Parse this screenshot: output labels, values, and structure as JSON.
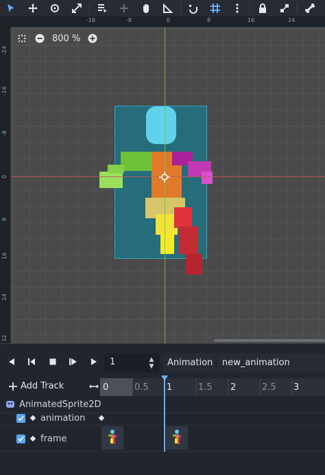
{
  "toolbar": {
    "icons": [
      "select-icon",
      "move-icon",
      "rotate-icon",
      "scale-icon",
      "list-select-icon",
      "pivot-icon",
      "pan-icon",
      "ruler-icon",
      "smart-snap-icon",
      "grid-snap-icon",
      "more-icon",
      "lock-icon",
      "group-icon",
      "bone-icon"
    ]
  },
  "rulers": {
    "top": [
      "-16",
      "-8",
      "0",
      "8",
      "16",
      "24"
    ],
    "left": [
      "-24",
      "-16",
      "-8",
      "0",
      "8",
      "16",
      "24",
      "32"
    ]
  },
  "viewport": {
    "zoom_text": "800 %"
  },
  "animation_panel": {
    "frame_value": "1",
    "animation_label": "Animation",
    "animation_name": "new_animation",
    "add_track_label": "Add Track",
    "timeline_labels": [
      "0",
      "0.5",
      "1",
      "1.5",
      "2",
      "2.5",
      "3"
    ],
    "node_name": "AnimatedSprite2D",
    "tracks": [
      {
        "label": "animation"
      },
      {
        "label": "frame"
      }
    ]
  },
  "colors": {
    "accent": "#6aaef7",
    "sprite_bg": "#1b788c"
  }
}
